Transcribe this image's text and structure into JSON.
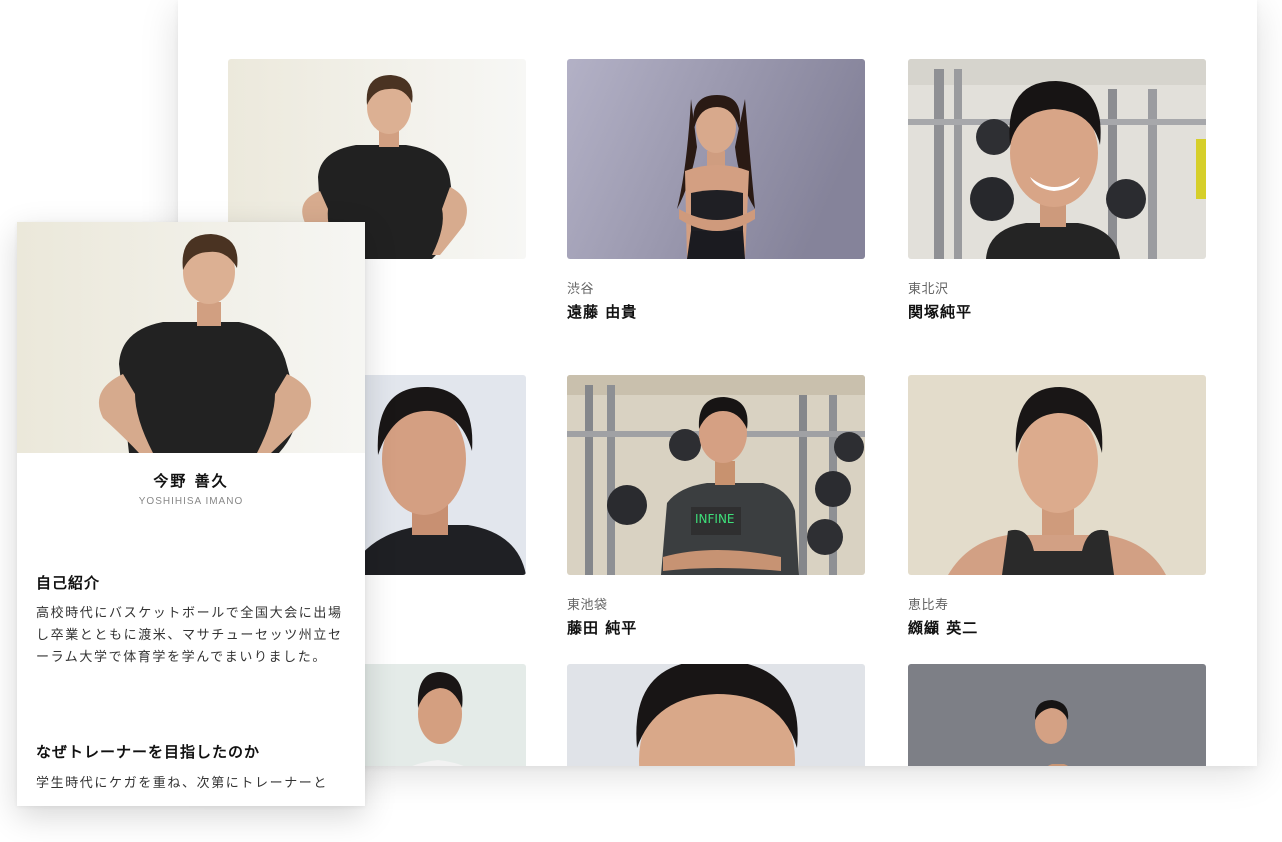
{
  "trainers": [
    {
      "area": "",
      "name": ""
    },
    {
      "area": "渋谷",
      "name": "遠藤 由貴"
    },
    {
      "area": "東北沢",
      "name": "関塚純平"
    },
    {
      "area": "",
      "name": ""
    },
    {
      "area": "東池袋",
      "name": "藤田 純平"
    },
    {
      "area": "恵比寿",
      "name": "纐纈 英二"
    },
    {
      "area": "",
      "name": ""
    },
    {
      "area": "",
      "name": ""
    },
    {
      "area": "",
      "name": ""
    }
  ],
  "profile": {
    "name": "今野 善久",
    "name_en": "YOSHIHISA IMANO",
    "sections": [
      {
        "title": "自己紹介",
        "text": "高校時代にバスケットボールで全国大会に出場し卒業とともに渡米、マサチューセッツ州立セーラム大学で体育学を学んでまいりました。"
      },
      {
        "title": "なぜトレーナーを目指したのか",
        "text": "学生時代にケガを重ね、次第にトレーナーと"
      }
    ]
  },
  "colors": {
    "card_bg": "#ffffff",
    "shirt_dark": "#1f1f1f",
    "skin": "#d9a585"
  }
}
